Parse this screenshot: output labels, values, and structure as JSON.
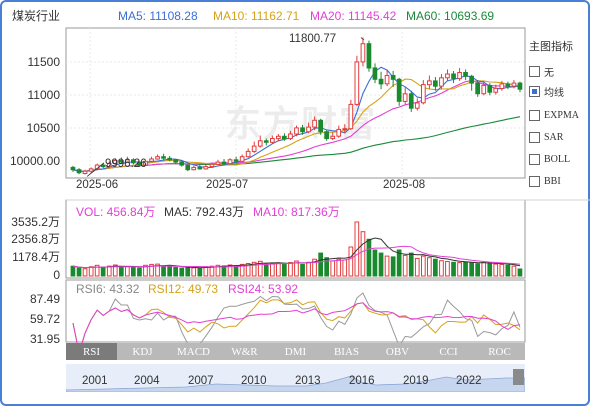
{
  "header": {
    "title": "煤炭行业",
    "ma5": "MA5: 11108.28",
    "ma10": "MA10: 11162.71",
    "ma20": "MA20: 11145.42",
    "ma60": "MA60: 10693.69"
  },
  "watermark": "东方财富",
  "price_axis": [
    "11500",
    "11000",
    "10500",
    "10000.00"
  ],
  "x_axis": [
    "2025-06",
    "2025-07",
    "2025-08"
  ],
  "annotations": {
    "high": "11800.77",
    "low": "9996.26"
  },
  "side_panel": {
    "title": "主图指标",
    "items": [
      {
        "label": "无",
        "checked": false
      },
      {
        "label": "均线",
        "checked": true
      },
      {
        "label": "EXPMA",
        "checked": false
      },
      {
        "label": "SAR",
        "checked": false
      },
      {
        "label": "BOLL",
        "checked": false
      },
      {
        "label": "BBI",
        "checked": false
      }
    ]
  },
  "volume": {
    "vol": "VOL: 456.84万",
    "ma5": "MA5: 792.43万",
    "ma10": "MA10: 817.36万",
    "axis": [
      "3535.2万",
      "2356.8万",
      "1178.4万",
      "0"
    ]
  },
  "rsi": {
    "rsi6": "RSI6: 43.32",
    "rsi12": "RSI12: 49.73",
    "rsi24": "RSI24: 53.92",
    "axis": [
      "87.49",
      "59.72",
      "31.95"
    ]
  },
  "tabs": [
    "RSI",
    "KDJ",
    "MACD",
    "W&R",
    "DMI",
    "BIAS",
    "OBV",
    "CCI",
    "ROC"
  ],
  "active_tab": "RSI",
  "timeline_years": [
    "2001",
    "2004",
    "2007",
    "2010",
    "2013",
    "2016",
    "2019",
    "2022"
  ],
  "colors": {
    "up": "#e23c3c",
    "down": "#1a8a2e",
    "ma5": "#3a6fd6",
    "ma10": "#d6a216",
    "ma20": "#e23fd6",
    "ma60": "#1a8a3a",
    "frame": "#4a7fd6"
  },
  "chart_data": {
    "type": "candlestick",
    "price_range": [
      9950,
      11900
    ],
    "candles": [
      {
        "o": 10090,
        "c": 10060,
        "h": 10110,
        "l": 10030
      },
      {
        "o": 10060,
        "c": 10020,
        "h": 10080,
        "l": 10000
      },
      {
        "o": 10010,
        "c": 10040,
        "h": 10060,
        "l": 9996.26
      },
      {
        "o": 10040,
        "c": 10070,
        "h": 10090,
        "l": 10020
      },
      {
        "o": 10070,
        "c": 10120,
        "h": 10140,
        "l": 10050
      },
      {
        "o": 10120,
        "c": 10100,
        "h": 10150,
        "l": 10080
      },
      {
        "o": 10100,
        "c": 10140,
        "h": 10170,
        "l": 10090
      },
      {
        "o": 10140,
        "c": 10180,
        "h": 10210,
        "l": 10120
      },
      {
        "o": 10180,
        "c": 10160,
        "h": 10220,
        "l": 10140
      },
      {
        "o": 10160,
        "c": 10190,
        "h": 10230,
        "l": 10150
      },
      {
        "o": 10190,
        "c": 10150,
        "h": 10210,
        "l": 10130
      },
      {
        "o": 10150,
        "c": 10120,
        "h": 10170,
        "l": 10100
      },
      {
        "o": 10120,
        "c": 10170,
        "h": 10190,
        "l": 10110
      },
      {
        "o": 10170,
        "c": 10200,
        "h": 10230,
        "l": 10160
      },
      {
        "o": 10200,
        "c": 10230,
        "h": 10260,
        "l": 10190
      },
      {
        "o": 10230,
        "c": 10210,
        "h": 10270,
        "l": 10190
      },
      {
        "o": 10210,
        "c": 10190,
        "h": 10240,
        "l": 10170
      },
      {
        "o": 10190,
        "c": 10160,
        "h": 10200,
        "l": 10130
      },
      {
        "o": 10160,
        "c": 10120,
        "h": 10180,
        "l": 10100
      },
      {
        "o": 10120,
        "c": 10060,
        "h": 10130,
        "l": 10040
      },
      {
        "o": 10060,
        "c": 10090,
        "h": 10110,
        "l": 10050
      },
      {
        "o": 10090,
        "c": 10070,
        "h": 10120,
        "l": 10060
      },
      {
        "o": 10070,
        "c": 10100,
        "h": 10130,
        "l": 10060
      },
      {
        "o": 10100,
        "c": 10130,
        "h": 10150,
        "l": 10090
      },
      {
        "o": 10130,
        "c": 10160,
        "h": 10190,
        "l": 10120
      },
      {
        "o": 10160,
        "c": 10140,
        "h": 10200,
        "l": 10120
      },
      {
        "o": 10140,
        "c": 10190,
        "h": 10210,
        "l": 10130
      },
      {
        "o": 10190,
        "c": 10170,
        "h": 10230,
        "l": 10150
      },
      {
        "o": 10170,
        "c": 10230,
        "h": 10260,
        "l": 10160
      },
      {
        "o": 10230,
        "c": 10300,
        "h": 10340,
        "l": 10220
      },
      {
        "o": 10300,
        "c": 10370,
        "h": 10430,
        "l": 10280
      },
      {
        "o": 10370,
        "c": 10440,
        "h": 10510,
        "l": 10350
      },
      {
        "o": 10440,
        "c": 10420,
        "h": 10470,
        "l": 10380
      },
      {
        "o": 10420,
        "c": 10470,
        "h": 10510,
        "l": 10400
      },
      {
        "o": 10470,
        "c": 10500,
        "h": 10530,
        "l": 10440
      },
      {
        "o": 10500,
        "c": 10470,
        "h": 10540,
        "l": 10440
      },
      {
        "o": 10470,
        "c": 10530,
        "h": 10570,
        "l": 10450
      },
      {
        "o": 10530,
        "c": 10610,
        "h": 10640,
        "l": 10500
      },
      {
        "o": 10610,
        "c": 10560,
        "h": 10650,
        "l": 10520
      },
      {
        "o": 10560,
        "c": 10620,
        "h": 10680,
        "l": 10540
      },
      {
        "o": 10620,
        "c": 10710,
        "h": 10760,
        "l": 10580
      },
      {
        "o": 10710,
        "c": 10560,
        "h": 10730,
        "l": 10520
      },
      {
        "o": 10560,
        "c": 10470,
        "h": 10580,
        "l": 10440
      },
      {
        "o": 10470,
        "c": 10500,
        "h": 10550,
        "l": 10450
      },
      {
        "o": 10500,
        "c": 10590,
        "h": 10640,
        "l": 10480
      },
      {
        "o": 10590,
        "c": 10600,
        "h": 10660,
        "l": 10540
      },
      {
        "o": 10600,
        "c": 10920,
        "h": 10980,
        "l": 10580
      },
      {
        "o": 10920,
        "c": 11480,
        "h": 11560,
        "l": 10900
      },
      {
        "o": 11480,
        "c": 11720,
        "h": 11800.77,
        "l": 11420
      },
      {
        "o": 11720,
        "c": 11400,
        "h": 11760,
        "l": 11350
      },
      {
        "o": 11400,
        "c": 11250,
        "h": 11460,
        "l": 11200
      },
      {
        "o": 11250,
        "c": 11190,
        "h": 11350,
        "l": 11120
      },
      {
        "o": 11190,
        "c": 11300,
        "h": 11380,
        "l": 11160
      },
      {
        "o": 11300,
        "c": 11250,
        "h": 11360,
        "l": 11150
      },
      {
        "o": 11250,
        "c": 10960,
        "h": 11270,
        "l": 10900
      },
      {
        "o": 10960,
        "c": 11060,
        "h": 11150,
        "l": 10920
      },
      {
        "o": 11060,
        "c": 10870,
        "h": 11100,
        "l": 10820
      },
      {
        "o": 10870,
        "c": 10940,
        "h": 11000,
        "l": 10840
      },
      {
        "o": 10940,
        "c": 11180,
        "h": 11240,
        "l": 10920
      },
      {
        "o": 11180,
        "c": 11230,
        "h": 11300,
        "l": 11120
      },
      {
        "o": 11230,
        "c": 11160,
        "h": 11280,
        "l": 11100
      },
      {
        "o": 11160,
        "c": 11270,
        "h": 11320,
        "l": 11120
      },
      {
        "o": 11270,
        "c": 11320,
        "h": 11380,
        "l": 11230
      },
      {
        "o": 11320,
        "c": 11260,
        "h": 11360,
        "l": 11200
      },
      {
        "o": 11260,
        "c": 11340,
        "h": 11400,
        "l": 11230
      },
      {
        "o": 11340,
        "c": 11290,
        "h": 11380,
        "l": 11240
      },
      {
        "o": 11290,
        "c": 11200,
        "h": 11310,
        "l": 11100
      },
      {
        "o": 11200,
        "c": 11060,
        "h": 11240,
        "l": 11020
      },
      {
        "o": 11060,
        "c": 11170,
        "h": 11230,
        "l": 11040
      },
      {
        "o": 11170,
        "c": 11080,
        "h": 11200,
        "l": 11040
      },
      {
        "o": 11080,
        "c": 11130,
        "h": 11180,
        "l": 11050
      },
      {
        "o": 11130,
        "c": 11190,
        "h": 11230,
        "l": 11100
      },
      {
        "o": 11190,
        "c": 11160,
        "h": 11220,
        "l": 11120
      },
      {
        "o": 11160,
        "c": 11200,
        "h": 11240,
        "l": 11130
      },
      {
        "o": 11200,
        "c": 11120,
        "h": 11220,
        "l": 11080
      }
    ],
    "volumes": [
      640,
      520,
      480,
      600,
      700,
      560,
      650,
      720,
      590,
      610,
      580,
      520,
      700,
      760,
      780,
      650,
      600,
      560,
      520,
      580,
      540,
      520,
      610,
      640,
      700,
      660,
      720,
      680,
      760,
      820,
      900,
      960,
      780,
      820,
      860,
      800,
      880,
      980,
      760,
      900,
      1100,
      1500,
      1200,
      980,
      1100,
      1050,
      1900,
      3535,
      2900,
      2400,
      1700,
      1500,
      1300,
      1250,
      1700,
      1350,
      1500,
      1150,
      1300,
      1200,
      1100,
      1000,
      950,
      900,
      880,
      920,
      860,
      800,
      900,
      820,
      780,
      760,
      720,
      650,
      456.84
    ],
    "vol_range": [
      0,
      3535.2
    ]
  }
}
